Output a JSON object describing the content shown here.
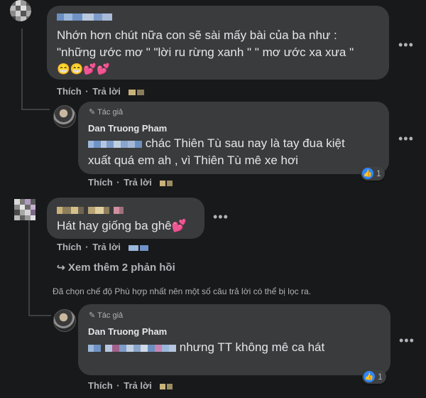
{
  "comment1": {
    "text_line1": "Nhớn hơn chút nữa con sẽ sài mấy bài của ba như :",
    "text_line2": "\"những ước mơ \" \"lời ru rừng xanh \" \" mơ ước xa xưa \"",
    "emojis": "😁😁💕💕",
    "like_label": "Thích",
    "dot": "·",
    "reply_label": "Trả lời"
  },
  "reply1": {
    "author_tag": "Tác giả",
    "author_name": "Dan Truong Pham",
    "text_line1": "chác Thiên Tù sau nay là tay đua kiệt",
    "text_line2": "xuất quá em ah , vì Thiên Tù mê xe hơi",
    "like_label": "Thích",
    "dot": "·",
    "reply_label": "Trả lời",
    "reaction_count": "1",
    "reaction_icon": "like-icon"
  },
  "comment2": {
    "text": "Hát hay giống ba ghê💕",
    "like_label": "Thích",
    "dot": "·",
    "reply_label": "Trả lời"
  },
  "view_more_replies": "Xem thêm 2 phản hồi",
  "filter_notice": "Đã chọn chế độ Phù hợp nhất nên một số câu trả lời có thể bị lọc ra.",
  "reply2": {
    "author_tag": "Tác giả",
    "author_name": "Dan Truong Pham",
    "text": "nhưng TT không mê ca hát",
    "like_label": "Thích",
    "dot": "·",
    "reply_label": "Trả lời",
    "reaction_count": "1",
    "reaction_icon": "like-icon"
  },
  "more_options": "•••",
  "colors": {
    "background": "#18191a",
    "bubble": "#3a3b3c",
    "text": "#e4e6eb",
    "secondary": "#b0b3b8",
    "like_blue": "#2d88ff"
  }
}
